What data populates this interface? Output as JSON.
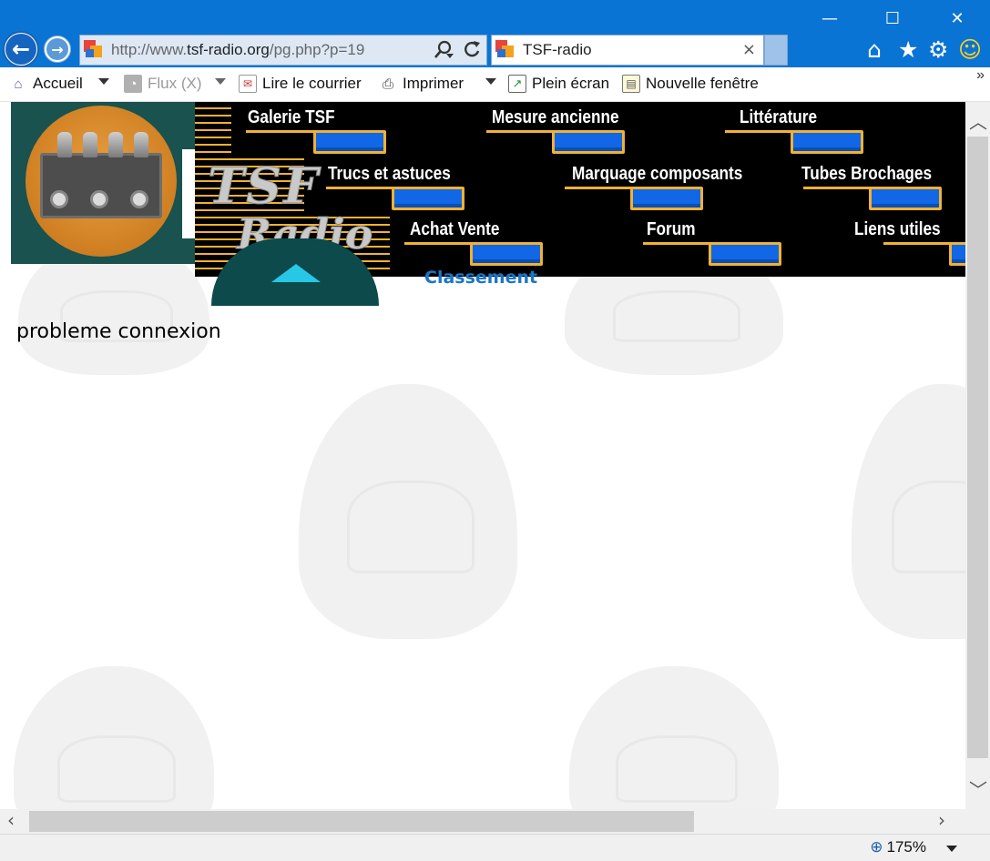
{
  "window": {
    "minimize_glyph": "—",
    "maximize_glyph": "☐",
    "close_glyph": "✕"
  },
  "nav": {
    "back_glyph": "←",
    "forward_glyph": "→"
  },
  "address": {
    "prefix": "http://www.",
    "host": "tsf-radio.org",
    "path": "/pg.php?p=19"
  },
  "tab": {
    "title": "TSF-radio",
    "close_glyph": "×"
  },
  "toolbar_icons": {
    "home": "⌂",
    "favorites": "★",
    "tools": "⚙",
    "feedback": "☺"
  },
  "commands": {
    "home": "Accueil",
    "feeds": "Flux (X)",
    "mail": "Lire le courrier",
    "print": "Imprimer",
    "fullscreen": "Plein écran",
    "new_window": "Nouvelle fenêtre",
    "more": "»"
  },
  "menu": {
    "logo_tsf": "TSF",
    "logo_radio": "Radio",
    "items": [
      {
        "label": "Galerie TSF"
      },
      {
        "label": "Mesure ancienne"
      },
      {
        "label": "Littérature"
      },
      {
        "label": "Trucs et astuces"
      },
      {
        "label": "Marquage composants"
      },
      {
        "label": "Tubes Brochages"
      },
      {
        "label": "Achat Vente"
      },
      {
        "label": "Forum"
      },
      {
        "label": "Liens utiles"
      }
    ]
  },
  "page": {
    "classement": "Classement",
    "message": "probleme connexion"
  },
  "status": {
    "zoom": "175%"
  },
  "colors": {
    "titlebar": "#0a74d4",
    "menu_accent": "#f0b232",
    "menu_button": "#1167e6",
    "link": "#1976c8"
  }
}
